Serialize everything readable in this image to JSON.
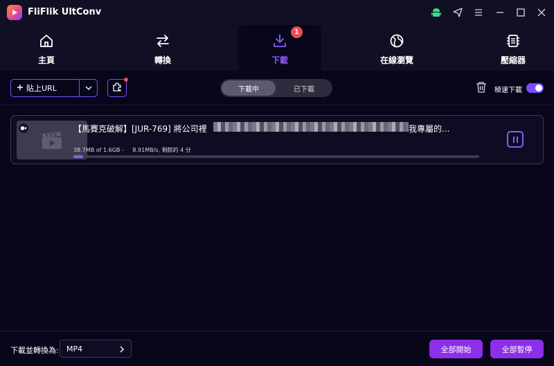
{
  "app": {
    "title": "FliFlik UltConv",
    "logo_icon": "app-logo-icon"
  },
  "window_controls": [
    "android-icon",
    "send-icon",
    "menu-icon",
    "minimize-icon",
    "maximize-icon",
    "close-icon"
  ],
  "nav": {
    "tabs": [
      {
        "label": "主頁",
        "icon": "home-icon",
        "active": false
      },
      {
        "label": "轉換",
        "icon": "convert-arrows-icon",
        "active": false
      },
      {
        "label": "下載",
        "icon": "download-icon",
        "active": true,
        "badge": "1"
      },
      {
        "label": "在線瀏覽",
        "icon": "globe-icon",
        "active": false
      },
      {
        "label": "壓縮器",
        "icon": "compress-icon",
        "active": false
      }
    ]
  },
  "toolbar": {
    "paste_label": "貼上URL",
    "segments": [
      {
        "label": "下載中",
        "active": true
      },
      {
        "label": "已下載",
        "active": false
      }
    ],
    "turbo_label": "極速下載",
    "turbo_on": true
  },
  "download_item": {
    "title": "【馬賽克破解】[JUR-769] 將公司裡",
    "title_end": "我專屬的...",
    "size_text": "38.7MB of 1.6GB -",
    "speed_text": "8.91MB/s, 剩餘的 4 分",
    "progress": 0.024
  },
  "footer": {
    "convert_label": "下載並轉換為:",
    "format_value": "MP4",
    "start_all_label": "全部開始",
    "pause_all_label": "全部暫停"
  },
  "colors": {
    "accent": "#8b5cf6",
    "button": "#8b2fe8",
    "badge": "#f04b4b",
    "background": "#07061a",
    "bar": "#100f24"
  }
}
